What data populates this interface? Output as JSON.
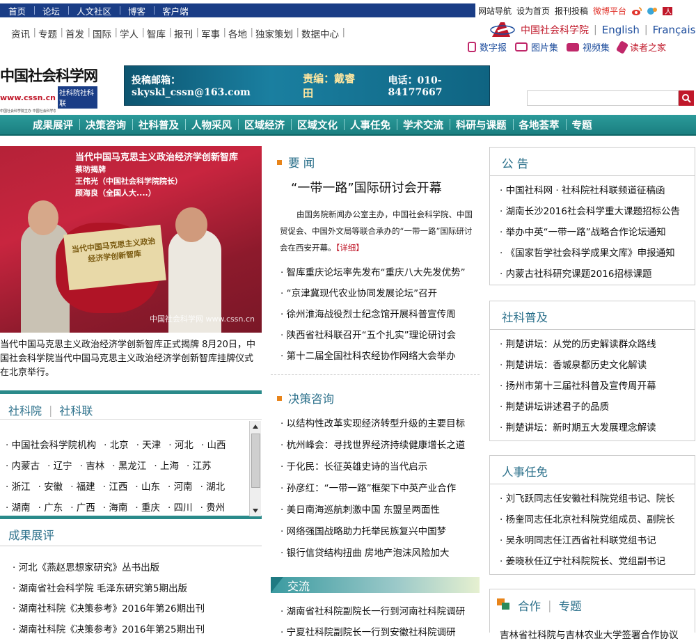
{
  "topbar": {
    "tabs": [
      "首页",
      "论坛",
      "人文社区",
      "博客",
      "客户端"
    ],
    "right_links": [
      "网站导航",
      "设为首页",
      "报刊投稿"
    ],
    "weibo": "微博平台"
  },
  "subnav": [
    "资讯",
    "专题",
    "首发",
    "国际",
    "学人",
    "智库",
    "报刊",
    "军事",
    "各地",
    "独家策划",
    "数据中心"
  ],
  "cass_links": {
    "cass": "中国社会科学院",
    "english": "English",
    "french": "Français"
  },
  "media": [
    "数字报",
    "图片集",
    "视频集",
    "读者之家"
  ],
  "logo": {
    "name": "中国社会科学网",
    "url": "www.cssn.cn",
    "sub": "社科院社科联",
    "tiny": "中国社会科学院主办 中国社会科学杂志社承办"
  },
  "banner": {
    "email": "投稿邮箱：skyskl_cssn@163.com",
    "editor": "责编：戴睿田",
    "phone": "电话：010-84177667"
  },
  "mainnav": [
    "成果展评",
    "决策咨询",
    "社科普及",
    "人物采风",
    "区域经济",
    "区域文化",
    "人事任免",
    "学术交流",
    "科研与课题",
    "各地荟萃",
    "专题"
  ],
  "photo": {
    "sign_lines": [
      "当代中国马克思主义政治经济学创新智库",
      "蔡昉揭牌",
      "王伟光（中国社会科学院院长）",
      "顾海良（全国人大....）"
    ],
    "plaque": "当代中国马克思主义政治经济学创新智库",
    "watermark": "中国社会科学网 www.cssn.cn",
    "caption": "当代中国马克思主义政治经济学创新智库正式揭牌 8月20日，中国社会科学院当代中国马克思主义政治经济学创新智库挂牌仪式在北京举行。"
  },
  "skbox": {
    "tab1": "社科院",
    "tab2": "社科联",
    "rows": [
      [
        "中国社会科学院机构",
        "北京",
        "天津",
        "河北",
        "山西"
      ],
      [
        "内蒙古",
        "辽宁",
        "吉林",
        "黑龙江",
        "上海",
        "江苏"
      ],
      [
        "浙江",
        "安徽",
        "福建",
        "江西",
        "山东",
        "河南",
        "湖北"
      ],
      [
        "湖南",
        "广东",
        "广西",
        "海南",
        "重庆",
        "四川",
        "贵州"
      ]
    ]
  },
  "achievements": {
    "title": "成果展评",
    "items": [
      "· 河北《燕赵思想家研究》丛书出版",
      "· 湖南省社会科学院 毛泽东研究第5期出版",
      "· 湖南社科院《决策参考》2016年第26期出刊",
      "· 湖南社科院《决策参考》2016年第25期出刊"
    ]
  },
  "news": {
    "title": "要 闻",
    "headline": "“一带一路”国际研讨会开幕",
    "summary": "由国务院新闻办公室主办，中国社会科学院、中国贸促会、中国外文局等联合承办的“一带一路”国际研讨会在西安开幕。",
    "more": "【详细】",
    "items": [
      "智库重庆论坛率先发布“重庆八大先发优势”",
      "“京津冀现代农业协同发展论坛”召开",
      "徐州淮海战役烈士纪念馆开展科普宣传周",
      "陕西省社科联召开“五个扎实”理论研讨会",
      "第十二届全国社科农经协作网络大会举办"
    ]
  },
  "policy": {
    "title": "决策咨询",
    "items": [
      "以结构性改革实现经济转型升级的主要目标",
      "杭州峰会：寻找世界经济持续健康增长之道",
      "于化民：长征英雄史诗的当代启示",
      "孙彦红：“一带一路”框架下中英产业合作",
      "美日南海巡航刺激中国 东盟呈两面性",
      "网络强国战略助力托举民族复兴中国梦",
      "银行信贷结构扭曲 房地产泡沫风险加大"
    ]
  },
  "exchange": {
    "title": "交流",
    "items": [
      "湖南省社科院副院长一行到河南社科院调研",
      "宁夏社科院副院长一行到安徽社科院调研"
    ]
  },
  "notice": {
    "title": "公 告",
    "items": [
      "中国社科网 · 社科院社科联频道征稿函",
      "湖南长沙2016社会科学重大课题招标公告",
      "举办中英“一带一路”战略合作论坛通知",
      "《国家哲学社会科学成果文库》申报通知",
      "内蒙古社科研究课题2016招标课题"
    ]
  },
  "popular": {
    "title": "社科普及",
    "items": [
      "荆楚讲坛：从党的历史解读群众路线",
      "荆楚讲坛：香城泉都历史文化解读",
      "扬州市第十三届社科普及宣传周开幕",
      "荆楚讲坛讲述君子的品质",
      "荆楚讲坛：新时期五大发展理念解读"
    ]
  },
  "personnel": {
    "title": "人事任免",
    "items": [
      "刘飞跃同志任安徽社科院党组书记、院长",
      "杨奎同志任北京社科院党组成员、副院长",
      "吴永明同志任江西省社科联党组书记",
      "姜晓秋任辽宁社科院院长、党组副书记"
    ]
  },
  "coop": {
    "title": "合作",
    "special": "专题",
    "item": "吉林省社科院与吉林农业大学签署合作协议"
  },
  "colors": {
    "navy": "#1a3d86",
    "teal": "#1a7f80",
    "red": "#c0182a",
    "accent": "#e8841a",
    "heading": "#2a6f8a"
  }
}
